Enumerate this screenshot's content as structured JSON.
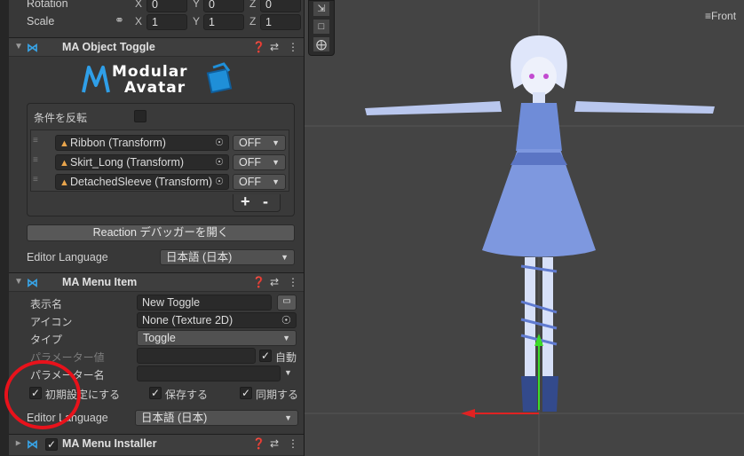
{
  "transform": {
    "rotation_label": "Rotation",
    "scale_label": "Scale",
    "rotation": {
      "x": "0",
      "y": "0",
      "z": "0"
    },
    "scale": {
      "x": "1",
      "y": "1",
      "z": "1"
    },
    "axes": {
      "x": "X",
      "y": "Y",
      "z": "Z"
    },
    "link_icon": "link-icon"
  },
  "object_toggle": {
    "title": "MA Object Toggle",
    "logo": {
      "line1": "Modular",
      "line2": "Avatar"
    },
    "invert_label": "条件を反転",
    "objects": [
      {
        "name": "Ribbon (Transform)",
        "state": "OFF"
      },
      {
        "name": "Skirt_Long (Transform)",
        "state": "OFF"
      },
      {
        "name": "DetachedSleeve (Transform)",
        "state": "OFF"
      }
    ],
    "add_label": "+",
    "remove_label": "-",
    "debugger_button": "Reaction デバッガーを開く",
    "editor_language_label": "Editor Language",
    "editor_language_value": "日本語 (日本)"
  },
  "menu_item": {
    "title": "MA Menu Item",
    "display_name_label": "表示名",
    "display_name_value": "New Toggle",
    "icon_label": "アイコン",
    "icon_value": "None (Texture 2D)",
    "type_label": "タイプ",
    "type_value": "Toggle",
    "param_value_label": "パラメーター値",
    "auto_label": "自動",
    "param_name_label": "パラメーター名",
    "default_label": "初期設定にする",
    "saved_label": "保存する",
    "synced_label": "同期する",
    "editor_language_label": "Editor Language",
    "editor_language_value": "日本語 (日本)"
  },
  "menu_installer": {
    "title": "MA Menu Installer"
  },
  "scene_view": {
    "view_label": "Front",
    "colors": {
      "highlight_circle": "#e8121b",
      "y_axis": "#3ddc2a",
      "x_axis": "#e02222"
    }
  }
}
